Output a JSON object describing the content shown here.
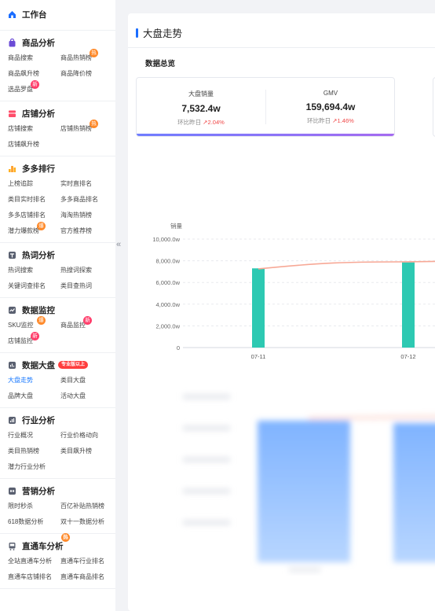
{
  "sidebar": {
    "workbench": "工作台",
    "sections": [
      {
        "key": "product",
        "title": "商品分析",
        "color": "#6b4cd6",
        "items": [
          {
            "label": "商品搜索"
          },
          {
            "label": "商品热销榜",
            "badge": "热"
          },
          {
            "label": "商品飙升榜"
          },
          {
            "label": "商品降价榜"
          },
          {
            "label": "选品罗盘",
            "badge": "新"
          }
        ]
      },
      {
        "key": "shop",
        "title": "店铺分析",
        "color": "#ff4d6a",
        "items": [
          {
            "label": "店铺搜索"
          },
          {
            "label": "店铺热销榜",
            "badge": "热"
          },
          {
            "label": "店铺飙升榜"
          }
        ]
      },
      {
        "key": "rank",
        "title": "多多排行",
        "color": "#ff9a1f",
        "items": [
          {
            "label": "上榜追踪"
          },
          {
            "label": "实时直排名"
          },
          {
            "label": "类目实时排名"
          },
          {
            "label": "多多商品排名"
          },
          {
            "label": "多多店铺排名"
          },
          {
            "label": "海淘热销榜"
          },
          {
            "label": "潜力爆款榜",
            "badge": "爆"
          },
          {
            "label": "官方推荐榜"
          }
        ]
      },
      {
        "key": "hotword",
        "title": "热词分析",
        "color": "#5a6070",
        "items": [
          {
            "label": "热词搜索"
          },
          {
            "label": "热搜词探索"
          },
          {
            "label": "关键词查排名"
          },
          {
            "label": "类目查热词"
          }
        ]
      },
      {
        "key": "monitor",
        "title": "数据监控",
        "color": "#5a6070",
        "items": [
          {
            "label": "SKU监控",
            "badge": "爆"
          },
          {
            "label": "商品监控",
            "badge": "新"
          },
          {
            "label": "店铺监控",
            "badge": "新"
          }
        ]
      },
      {
        "key": "board",
        "title": "数据大盘",
        "color": "#5a6070",
        "tag": "专业版以上",
        "items": [
          {
            "label": "大盘走势",
            "active": true
          },
          {
            "label": "类目大盘"
          },
          {
            "label": "品牌大盘"
          },
          {
            "label": "活动大盘"
          }
        ]
      },
      {
        "key": "industry",
        "title": "行业分析",
        "color": "#5a6070",
        "items": [
          {
            "label": "行业概况"
          },
          {
            "label": "行业价格动向"
          },
          {
            "label": "类目热销榜"
          },
          {
            "label": "类目飙升榜"
          },
          {
            "label": "潜力行业分析"
          }
        ]
      },
      {
        "key": "marketing",
        "title": "营销分析",
        "color": "#5a6070",
        "items": [
          {
            "label": "限时秒杀"
          },
          {
            "label": "百亿补贴热销榜"
          },
          {
            "label": "618数据分析"
          },
          {
            "label": "双十一数据分析"
          }
        ]
      },
      {
        "key": "ztc",
        "title": "直通车分析",
        "color": "#5a6070",
        "badge": "热",
        "items": [
          {
            "label": "全站直通车分析"
          },
          {
            "label": "直通车行业排名"
          },
          {
            "label": "直通车店铺排名"
          },
          {
            "label": "直通车商品排名"
          }
        ]
      }
    ]
  },
  "collapse_glyph": "«",
  "main": {
    "title": "大盘走势",
    "overview_title": "数据总览",
    "metrics": [
      {
        "label": "大盘销量",
        "value": "7,532.4w",
        "compare_label": "环比昨日",
        "compare_value": "2.04%"
      },
      {
        "label": "GMV",
        "value": "159,694.4w",
        "compare_label": "环比昨日",
        "compare_value": "1.46%"
      }
    ]
  },
  "chart_data": {
    "type": "bar",
    "ylabel": "销量",
    "y_tick_labels": [
      "0",
      "2,000.0w",
      "4,000.0w",
      "6,000.0w",
      "8,000.0w",
      "10,000.0w"
    ],
    "ylim": [
      0,
      10000
    ],
    "categories": [
      "07-11",
      "07-12"
    ],
    "series": [
      {
        "type": "bar",
        "values": [
          7300,
          7850
        ]
      },
      {
        "type": "line",
        "values": [
          7250,
          7900
        ]
      }
    ],
    "colors": {
      "bar": "#2dc9b2",
      "line": "#f7a896"
    }
  }
}
